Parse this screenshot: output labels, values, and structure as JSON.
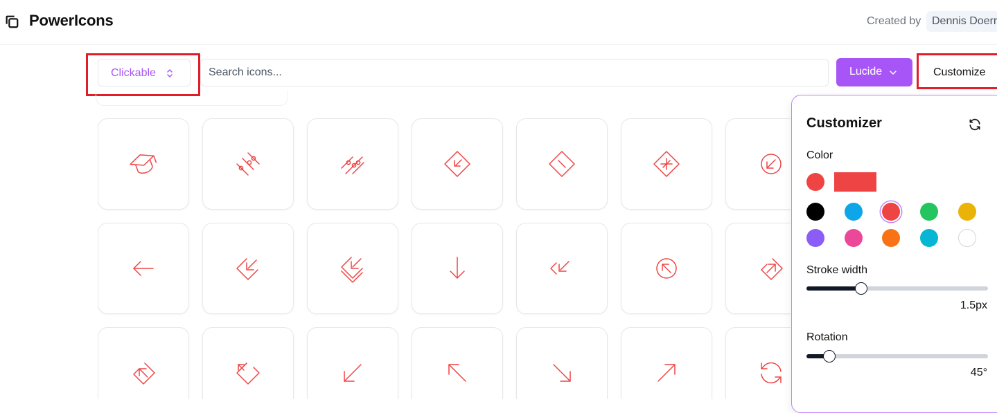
{
  "app": {
    "title": "PowerIcons",
    "credit_label": "Created by",
    "credit_name": "Dennis Doerr"
  },
  "toolbar": {
    "mode_select": "Clickable",
    "search_placeholder": "Search icons...",
    "library_button": "Lucide",
    "customize_button": "Customize"
  },
  "icons": [
    "graduation-cap-icon",
    "sliders-diagonal-icon",
    "sliders-slanted-icon",
    "badge-arrow-in-icon",
    "badge-minus-icon",
    "badge-plus-icon",
    "circle-arrow-down-left-icon",
    "arrow-left-icon",
    "tag-arrow-in-icon",
    "tags-arrow-in-icon",
    "arrow-down-icon",
    "arrow-down-left-double-icon",
    "circle-arrow-up-left-icon",
    "tag-arrow-out-icon",
    "tag-arrow-up-left-icon",
    "tag-arrow-out-alt-icon",
    "arrow-down-left-icon",
    "arrow-up-left-icon",
    "arrow-down-right-icon",
    "arrow-up-right-icon",
    "refresh-cw-icon"
  ],
  "customizer": {
    "title": "Customizer",
    "reset_icon": "refresh-icon",
    "color_label": "Color",
    "current_color": "#ef4444",
    "palette": [
      "#000000",
      "#0ea5e9",
      "#ef4444",
      "#22c55e",
      "#eab308",
      "#8b5cf6",
      "#ec4899",
      "#f97316",
      "#06b6d4",
      "#ffffff"
    ],
    "selected_color": "#ef4444",
    "stroke_label": "Stroke width",
    "stroke_value": "1.5px",
    "stroke_fraction": 0.3,
    "rotation_label": "Rotation",
    "rotation_value": "45°",
    "rotation_fraction": 0.125
  },
  "colors": {
    "accent": "#a855f7",
    "icon": "#ef4444",
    "highlight": "#e11d2a"
  }
}
